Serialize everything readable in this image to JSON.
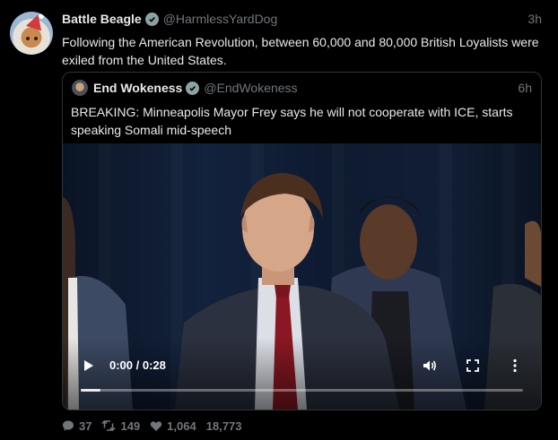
{
  "post": {
    "author_name": "Battle Beagle",
    "author_handle": "@HarmlessYardDog",
    "time": "3h",
    "text": "Following the American Revolution, between 60,000 and 80,000 British Loyalists were exiled from the United States.",
    "verified_badge_color": "#8ba3a4"
  },
  "quoted": {
    "author_name": "End Wokeness",
    "author_handle": "@EndWokeness",
    "time": "6h",
    "text": "BREAKING: Minneapolis Mayor Frey says he will not cooperate with ICE, starts speaking Somali mid-speech",
    "video": {
      "timecode": "0:00 / 0:28",
      "progress": 0.045,
      "icons": [
        "play-icon",
        "volume-icon",
        "fullscreen-icon",
        "more-vertical-icon"
      ]
    }
  },
  "actions": {
    "replies": "37",
    "reposts": "149",
    "likes": "1,064",
    "views": "18,773"
  },
  "colors": {
    "background": "#000000",
    "text": "#e7e9ea",
    "muted": "#71767b",
    "border": "#2f3336"
  }
}
